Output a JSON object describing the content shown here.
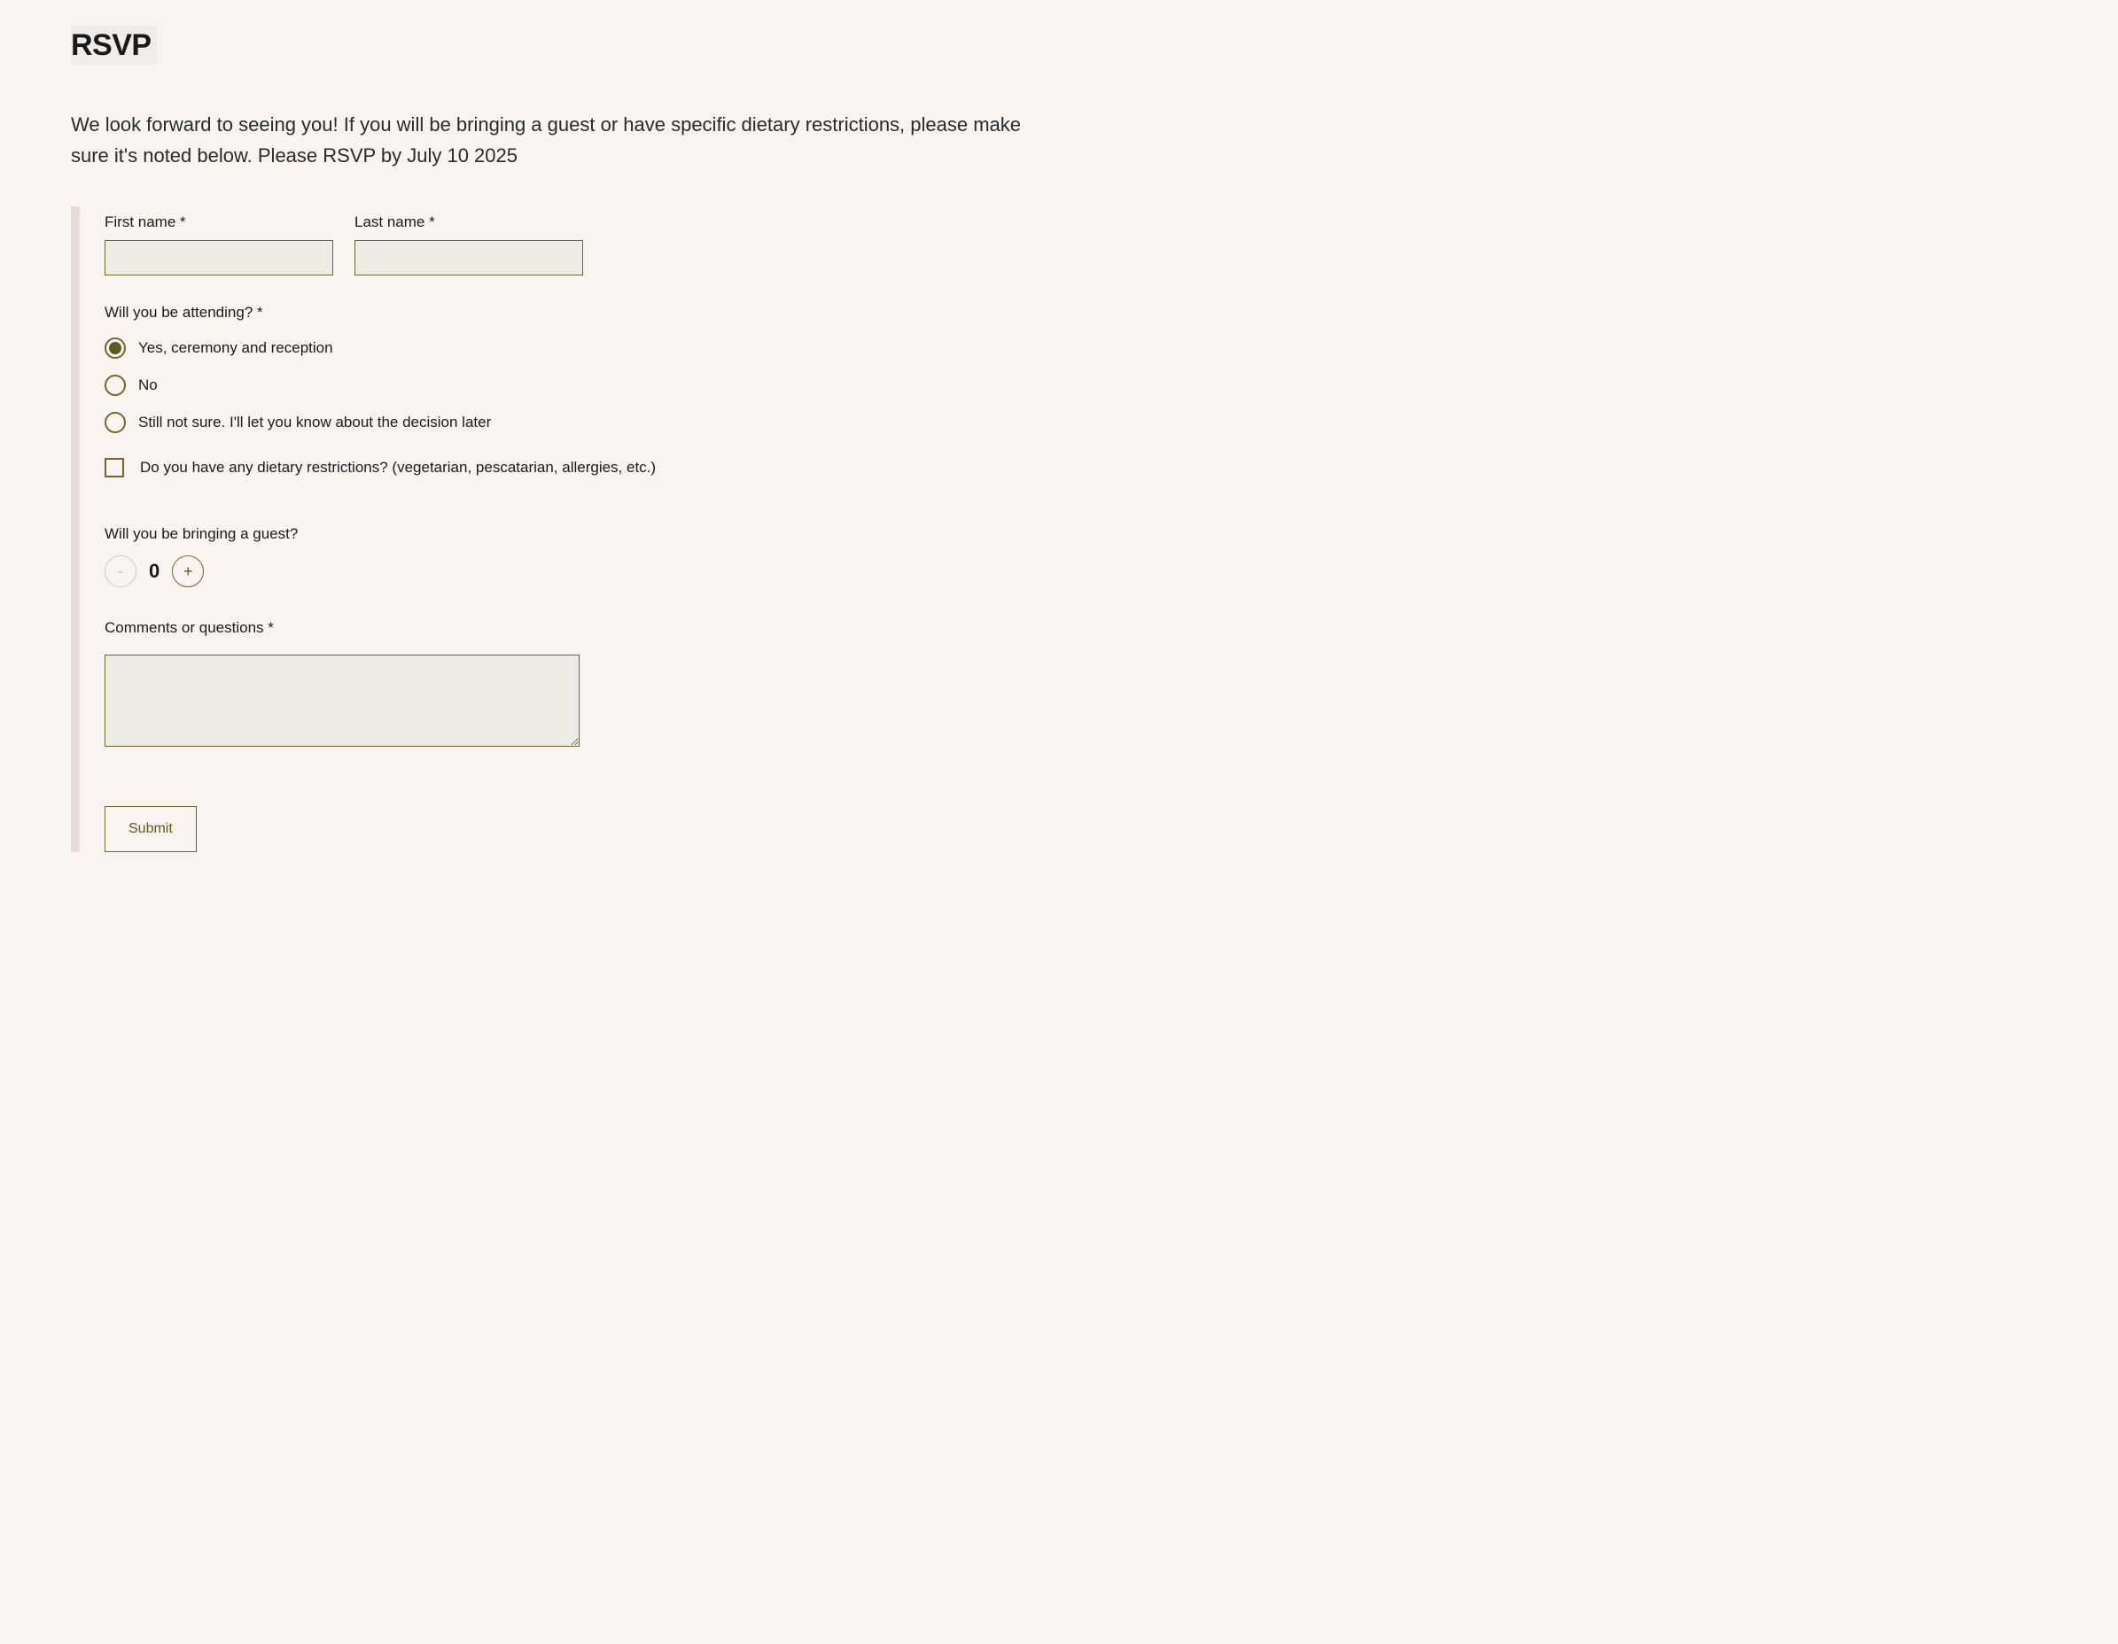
{
  "header": {
    "title": "RSVP",
    "intro": "We look forward to seeing you! If you will be bringing a guest or have specific dietary restrictions, please make sure it's noted below. Please RSVP by July 10 2025"
  },
  "form": {
    "first_name": {
      "label": "First name *",
      "value": ""
    },
    "last_name": {
      "label": "Last name *",
      "value": ""
    },
    "attending": {
      "label": "Will you be attending? *",
      "options": [
        {
          "label": "Yes, ceremony and reception",
          "selected": true
        },
        {
          "label": "No",
          "selected": false
        },
        {
          "label": "Still not sure. I'll let you know about the decision later",
          "selected": false
        }
      ]
    },
    "dietary": {
      "label": "Do you have any dietary restrictions? (vegetarian, pescatarian, allergies, etc.)",
      "checked": false
    },
    "guest": {
      "label": "Will you be bringing a guest?",
      "value": "0",
      "minus": "-",
      "plus": "+"
    },
    "comments": {
      "label": "Comments or questions *",
      "value": ""
    },
    "submit": {
      "label": "Submit"
    }
  }
}
